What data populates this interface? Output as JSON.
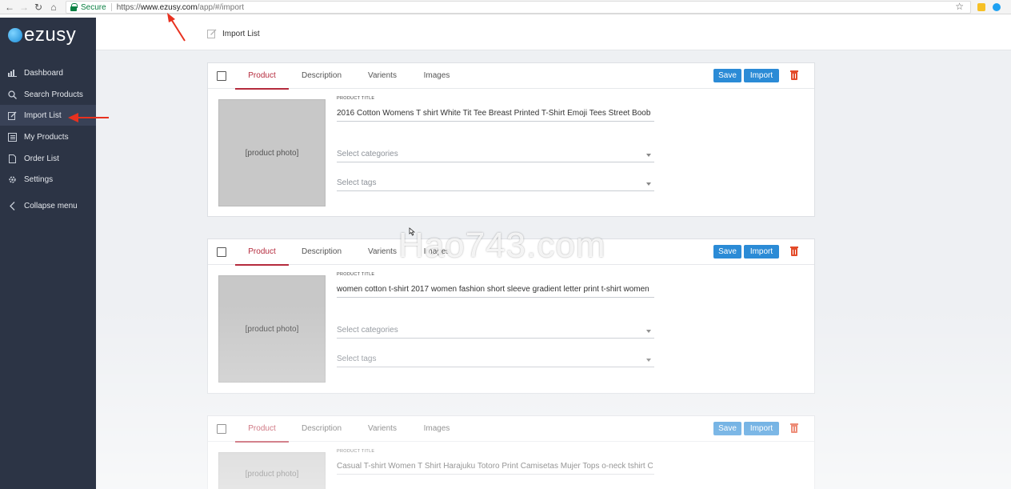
{
  "browser": {
    "secure_label": "Secure",
    "url_scheme": "https://",
    "url_host": "www.ezusy.com",
    "url_path": "/app/#/import"
  },
  "sidebar": {
    "logo_text": "ezusy",
    "items": [
      {
        "label": "Dashboard",
        "icon": "dashboard-icon"
      },
      {
        "label": "Search Products",
        "icon": "search-icon"
      },
      {
        "label": "Import List",
        "icon": "edit-icon"
      },
      {
        "label": "My Products",
        "icon": "list-icon"
      },
      {
        "label": "Order List",
        "icon": "file-icon"
      },
      {
        "label": "Settings",
        "icon": "gear-icon"
      },
      {
        "label": "Collapse menu",
        "icon": "chevron-left-icon"
      }
    ],
    "active_item": "Import List"
  },
  "header": {
    "title": "Import List"
  },
  "tabs": [
    "Product",
    "Description",
    "Varients",
    "Images"
  ],
  "buttons": {
    "save": "Save",
    "import": "Import"
  },
  "product_title_label": "PRODUCT TITLE",
  "categories_placeholder": "Select categories",
  "tags_placeholder": "Select tags",
  "products": [
    {
      "title": "2016 Cotton Womens T shirt White Tit Tee Breast Printed T-Shirt Emoji Tees Street Boob",
      "image_label": "[product photo]"
    },
    {
      "title": "women cotton t-shirt 2017 women fashion short sleeve gradient letter print t-shirt women",
      "image_label": "[product photo]"
    },
    {
      "title": "Casual T-shirt Women T Shirt Harajuku Totoro Print Camisetas Mujer Tops o-neck tshirt C",
      "image_label": "[product photo]"
    }
  ],
  "watermark": "Hao743.com",
  "colors": {
    "sidebar_bg": "#2c3445",
    "accent_blue": "#2b8bd6",
    "tab_active": "#b52b3d",
    "delete_red": "#e34b2a",
    "annotation_arrow": "#e8311f"
  }
}
